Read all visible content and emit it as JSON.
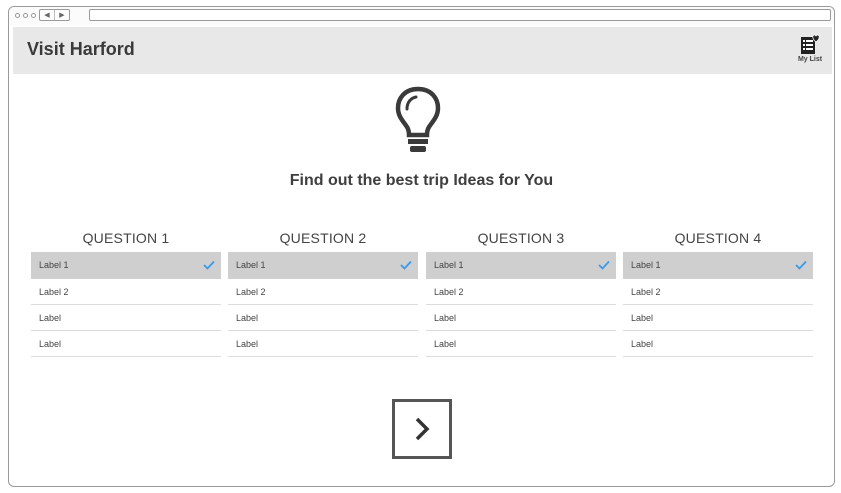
{
  "browser": {
    "back_glyph": "◀",
    "forward_glyph": "▶"
  },
  "app": {
    "title": "Visit Harford",
    "my_list_label": "My List",
    "my_list_icon": "list-heart-icon"
  },
  "hero": {
    "icon": "lightbulb-icon",
    "headline": "Find out the best trip Ideas for You"
  },
  "questions": [
    {
      "title": "QUESTION 1",
      "options": [
        {
          "label": "Label 1",
          "selected": true
        },
        {
          "label": "Label 2",
          "selected": false
        },
        {
          "label": "Label",
          "selected": false
        },
        {
          "label": "Label",
          "selected": false
        }
      ]
    },
    {
      "title": "QUESTION 2",
      "options": [
        {
          "label": "Label 1",
          "selected": true
        },
        {
          "label": "Label 2",
          "selected": false
        },
        {
          "label": "Label",
          "selected": false
        },
        {
          "label": "Label",
          "selected": false
        }
      ]
    },
    {
      "title": "QUESTION 3",
      "options": [
        {
          "label": "Label 1",
          "selected": true
        },
        {
          "label": "Label 2",
          "selected": false
        },
        {
          "label": "Label",
          "selected": false
        },
        {
          "label": "Label",
          "selected": false
        }
      ]
    },
    {
      "title": "QUESTION 4",
      "options": [
        {
          "label": "Label 1",
          "selected": true
        },
        {
          "label": "Label 2",
          "selected": false
        },
        {
          "label": "Label",
          "selected": false
        },
        {
          "label": "Label",
          "selected": false
        }
      ]
    }
  ],
  "next_button": {
    "icon": "chevron-right-icon"
  },
  "colors": {
    "check": "#3b9ae8",
    "selected_row": "#cfcfcf",
    "appbar": "#e8e8e8"
  }
}
